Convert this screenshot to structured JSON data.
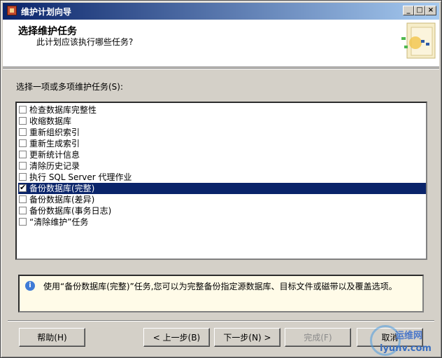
{
  "window": {
    "title": "维护计划向导"
  },
  "header": {
    "title": "选择维护任务",
    "subtitle": "此计划应该执行哪些任务?"
  },
  "prompt": "选择一项或多项维护任务(S):",
  "tasks": [
    {
      "label": "检查数据库完整性",
      "checked": false,
      "selected": false
    },
    {
      "label": "收缩数据库",
      "checked": false,
      "selected": false
    },
    {
      "label": "重新组织索引",
      "checked": false,
      "selected": false
    },
    {
      "label": "重新生成索引",
      "checked": false,
      "selected": false
    },
    {
      "label": "更新统计信息",
      "checked": false,
      "selected": false
    },
    {
      "label": "清除历史记录",
      "checked": false,
      "selected": false
    },
    {
      "label": "执行 SQL Server 代理作业",
      "checked": false,
      "selected": false
    },
    {
      "label": "备份数据库(完整)",
      "checked": true,
      "selected": true
    },
    {
      "label": "备份数据库(差异)",
      "checked": false,
      "selected": false
    },
    {
      "label": "备份数据库(事务日志)",
      "checked": false,
      "selected": false
    },
    {
      "label": "“清除维护”任务",
      "checked": false,
      "selected": false
    }
  ],
  "info": {
    "icon": "info-icon",
    "text": "使用“备份数据库(完整)”任务,您可以为完整备份指定源数据库、目标文件或磁带以及覆盖选项。"
  },
  "buttons": {
    "help": "帮助(H)",
    "back": "< 上一步(B)",
    "next": "下一步(N) >",
    "finish": "完成(F)",
    "cancel": "取消"
  },
  "watermark": {
    "cn": "运维网",
    "en": "iyunv.com"
  },
  "colors": {
    "selection": "#0a246a",
    "titlebar": "#0a246a",
    "info_bg": "#fffbe8"
  }
}
